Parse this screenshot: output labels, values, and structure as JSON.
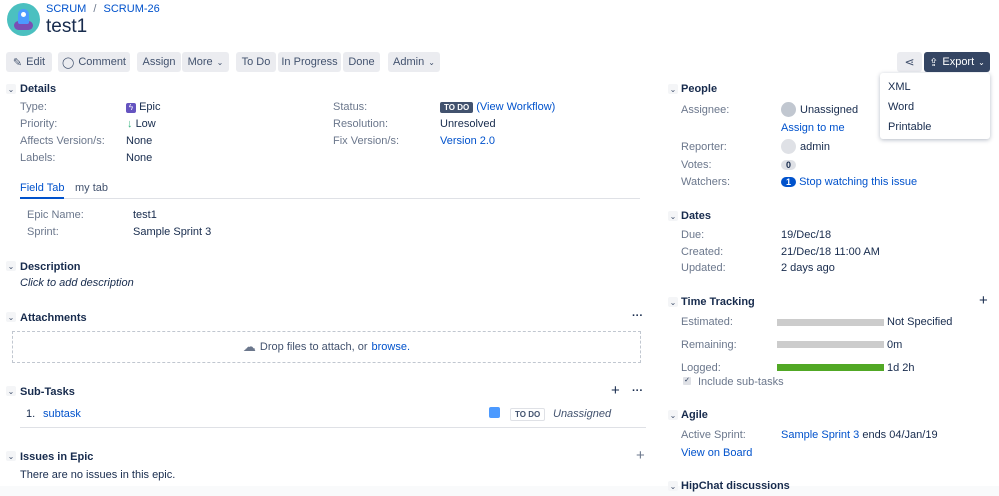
{
  "breadcrumb": {
    "project": "SCRUM",
    "issue_key": "SCRUM-26"
  },
  "title": "test1",
  "toolbar": {
    "edit": "Edit",
    "comment": "Comment",
    "assign": "Assign",
    "more": "More",
    "todo": "To Do",
    "in_progress": "In Progress",
    "done": "Done",
    "admin": "Admin",
    "export": "Export"
  },
  "export_menu": [
    "XML",
    "Word",
    "Printable"
  ],
  "details": {
    "heading": "Details",
    "type_label": "Type:",
    "type": "Epic",
    "priority_label": "Priority:",
    "priority": "Low",
    "affects_label": "Affects Version/s:",
    "affects": "None",
    "labels_label": "Labels:",
    "labels": "None",
    "status_label": "Status:",
    "status": "TO DO",
    "view_workflow": "(View Workflow)",
    "resolution_label": "Resolution:",
    "resolution": "Unresolved",
    "fix_label": "Fix Version/s:",
    "fix": "Version 2.0"
  },
  "tabs": [
    "Field Tab",
    "my tab"
  ],
  "tab_fields": {
    "epic_name_label": "Epic Name:",
    "epic_name": "test1",
    "sprint_label": "Sprint:",
    "sprint": "Sample Sprint 3"
  },
  "description": {
    "heading": "Description",
    "placeholder": "Click to add description"
  },
  "attachments": {
    "heading": "Attachments",
    "drop_text": "Drop files to attach, or",
    "browse": "browse."
  },
  "subtasks": {
    "heading": "Sub-Tasks",
    "items": [
      {
        "num": "1.",
        "name": "subtask",
        "status": "TO DO",
        "assignee": "Unassigned"
      }
    ]
  },
  "issues_in_epic": {
    "heading": "Issues in Epic",
    "empty": "There are no issues in this epic."
  },
  "people": {
    "heading": "People",
    "assignee_label": "Assignee:",
    "assignee": "Unassigned",
    "assign_to_me": "Assign to me",
    "reporter_label": "Reporter:",
    "reporter": "admin",
    "votes_label": "Votes:",
    "votes": "0",
    "watchers_label": "Watchers:",
    "watchers": "1",
    "stop_watching": "Stop watching this issue"
  },
  "dates": {
    "heading": "Dates",
    "due_label": "Due:",
    "due": "19/Dec/18",
    "created_label": "Created:",
    "created": "21/Dec/18 11:00 AM",
    "updated_label": "Updated:",
    "updated": "2 days ago"
  },
  "time_tracking": {
    "heading": "Time Tracking",
    "estimated_label": "Estimated:",
    "estimated": "Not Specified",
    "estimated_fill": 0,
    "remaining_label": "Remaining:",
    "remaining": "0m",
    "remaining_fill": 0,
    "logged_label": "Logged:",
    "logged": "1d 2h",
    "logged_fill": 1,
    "include_subtasks": "Include sub-tasks"
  },
  "agile": {
    "heading": "Agile",
    "active_sprint_label": "Active Sprint:",
    "sprint": "Sample Sprint 3",
    "ends": "ends 04/Jan/19",
    "view_on_board": "View on Board"
  },
  "hipchat": {
    "heading": "HipChat discussions"
  }
}
